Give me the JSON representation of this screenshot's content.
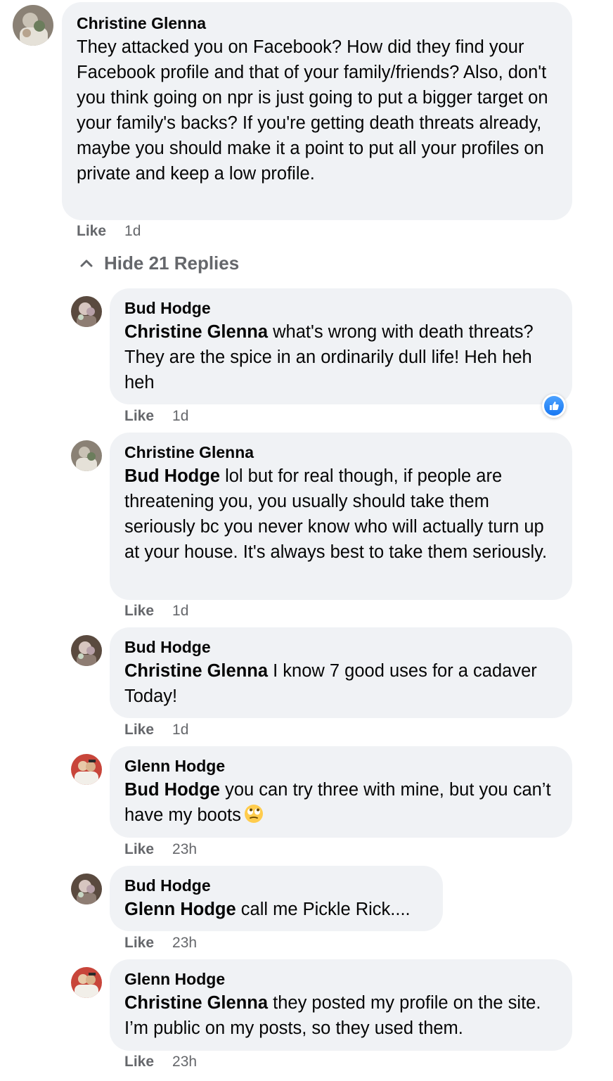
{
  "top_comment": {
    "author": "Christine Glenna",
    "text": "They attacked you on Facebook? How did they find your Facebook profile and that of your family/friends? Also, don't you think going on npr is just going to put a bigger target on your family's backs? If you're getting death threats already, maybe you should make it a point to put all your profiles on private and keep a low profile.",
    "like_label": "Like",
    "time": "1d"
  },
  "hide_replies_label": "Hide 21 Replies",
  "replies": [
    {
      "author": "Bud Hodge",
      "mention": "Christine Glenna",
      "text": " what's wrong with death threats? They are the spice in an ordinarily dull life! Heh heh heh",
      "like_label": "Like",
      "time": "1d",
      "reaction": "like-reaction-icon"
    },
    {
      "author": "Christine Glenna",
      "mention": "Bud Hodge",
      "text": " lol but for real though, if people are threatening you, you usually should take them seriously bc you never know who will actually turn up at your house. It's always best to take them seriously.",
      "like_label": "Like",
      "time": "1d"
    },
    {
      "author": "Bud Hodge",
      "mention": "Christine Glenna",
      "text": " I know 7 good uses for a cadaver Today!",
      "like_label": "Like",
      "time": "1d"
    },
    {
      "author": "Glenn Hodge",
      "mention": "Bud Hodge",
      "text": " you can try three with mine, but you can’t have my boots",
      "emoji": "eye-roll-emoji",
      "like_label": "Like",
      "time": "23h"
    },
    {
      "author": "Bud Hodge",
      "mention": "Glenn Hodge",
      "text": " call me Pickle Rick....",
      "like_label": "Like",
      "time": "23h"
    },
    {
      "author": "Glenn Hodge",
      "mention": "Christine Glenna",
      "text": " they posted my profile on the site. I’m public on my posts, so they used them.",
      "like_label": "Like",
      "time": "23h"
    }
  ],
  "colors": {
    "bubble": "#f0f2f5",
    "secondary_text": "#65676b",
    "like_blue": "#1877f2"
  }
}
